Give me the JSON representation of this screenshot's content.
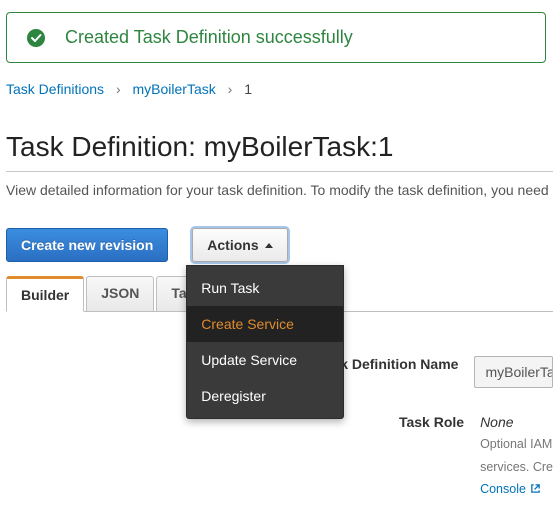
{
  "alert": {
    "message": "Created Task Definition successfully"
  },
  "breadcrumb": {
    "root": "Task Definitions",
    "task": "myBoilerTask",
    "revision": "1"
  },
  "page": {
    "title": "Task Definition: myBoilerTask:1",
    "subtitle": "View detailed information for your task definition. To modify the task definition, you need"
  },
  "buttons": {
    "create_revision": "Create new revision",
    "actions": "Actions"
  },
  "dropdown": {
    "items": [
      "Run Task",
      "Create Service",
      "Update Service",
      "Deregister"
    ],
    "active_index": 1
  },
  "tabs": {
    "items": [
      "Builder",
      "JSON",
      "Tags"
    ],
    "active_index": 0
  },
  "details": {
    "task_def_name_label": "Task Definition Name",
    "task_def_name_value": "myBoilerTa",
    "task_role_label": "Task Role",
    "task_role_value": "None",
    "task_role_help1": "Optional IAM",
    "task_role_help2": "services. Cre",
    "task_role_link": "Console"
  }
}
